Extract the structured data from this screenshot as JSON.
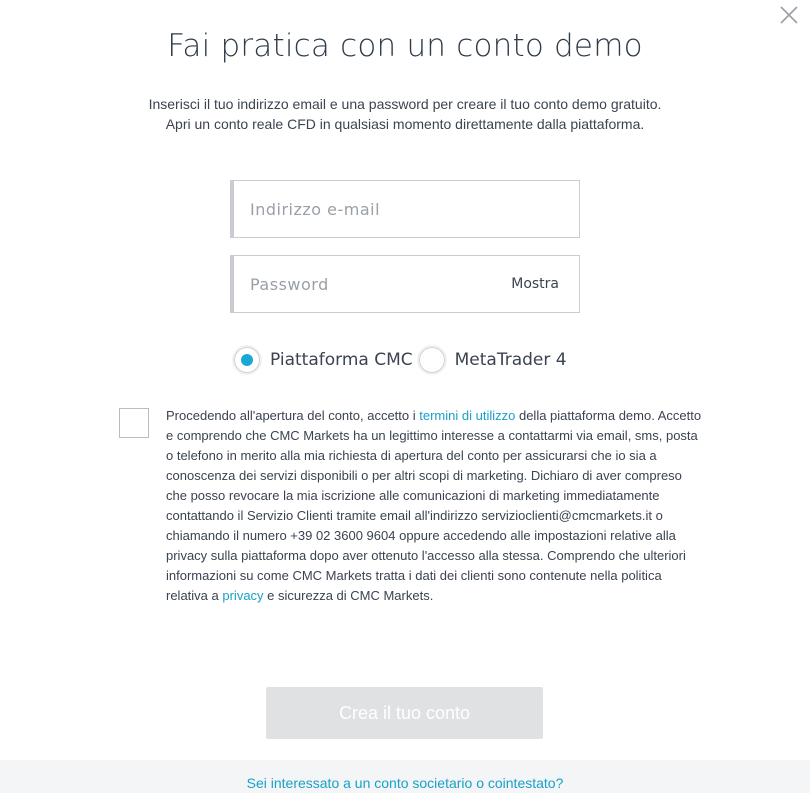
{
  "dialog": {
    "title": "Fai pratica con un conto demo",
    "intro": "Inserisci il tuo indirizzo email e una password per creare il tuo conto demo gratuito. Apri un conto reale CFD in qualsiasi momento direttamente dalla piattaforma."
  },
  "form": {
    "email_placeholder": "Indirizzo e-mail",
    "email_value": "",
    "password_placeholder": "Password",
    "password_value": "",
    "show_password_label": "Mostra"
  },
  "platforms": {
    "selected": "Piattaforma CMC",
    "options": [
      {
        "label": "Piattaforma CMC",
        "checked": true
      },
      {
        "label": "MetaTrader 4",
        "checked": false
      }
    ]
  },
  "consent": {
    "checked": false,
    "text_before_terms": "Procedendo all'apertura del conto, accetto i ",
    "terms_link": "termini di utilizzo",
    "text_after_terms": " della piattaforma demo. Accetto e comprendo che CMC Markets ha un legittimo interesse a contattarmi via email, sms, posta o telefono in merito alla mia richiesta di apertura del conto per assicurarsi che io sia a conoscenza dei servizi disponibili o per altri scopi di marketing. Dichiaro di aver compreso che posso revocare la mia iscrizione alle comunicazioni di marketing immediatamente contattando il Servizio Clienti tramite email all'indirizzo servizioclienti@cmcmarkets.it o chiamando il numero +39 02 3600 9604 oppure accedendo alle impostazioni relative alla privacy sulla piattaforma dopo aver ottenuto l'accesso alla stessa. Comprendo che ulteriori informazioni su come CMC Markets tratta i dati dei clienti sono contenute nella politica relativa a ",
    "privacy_link": "privacy",
    "text_end": " e sicurezza di CMC Markets."
  },
  "submit": {
    "label": "Crea il tuo conto",
    "enabled": false
  },
  "footer": {
    "link": "Sei interessato a un conto societario o cointestato?"
  },
  "colors": {
    "accent": "#19a8d6",
    "link": "#19a0c8",
    "button_disabled": "#e0e1e3",
    "text": "#3b4350"
  },
  "icons": {
    "close": "close-icon"
  }
}
